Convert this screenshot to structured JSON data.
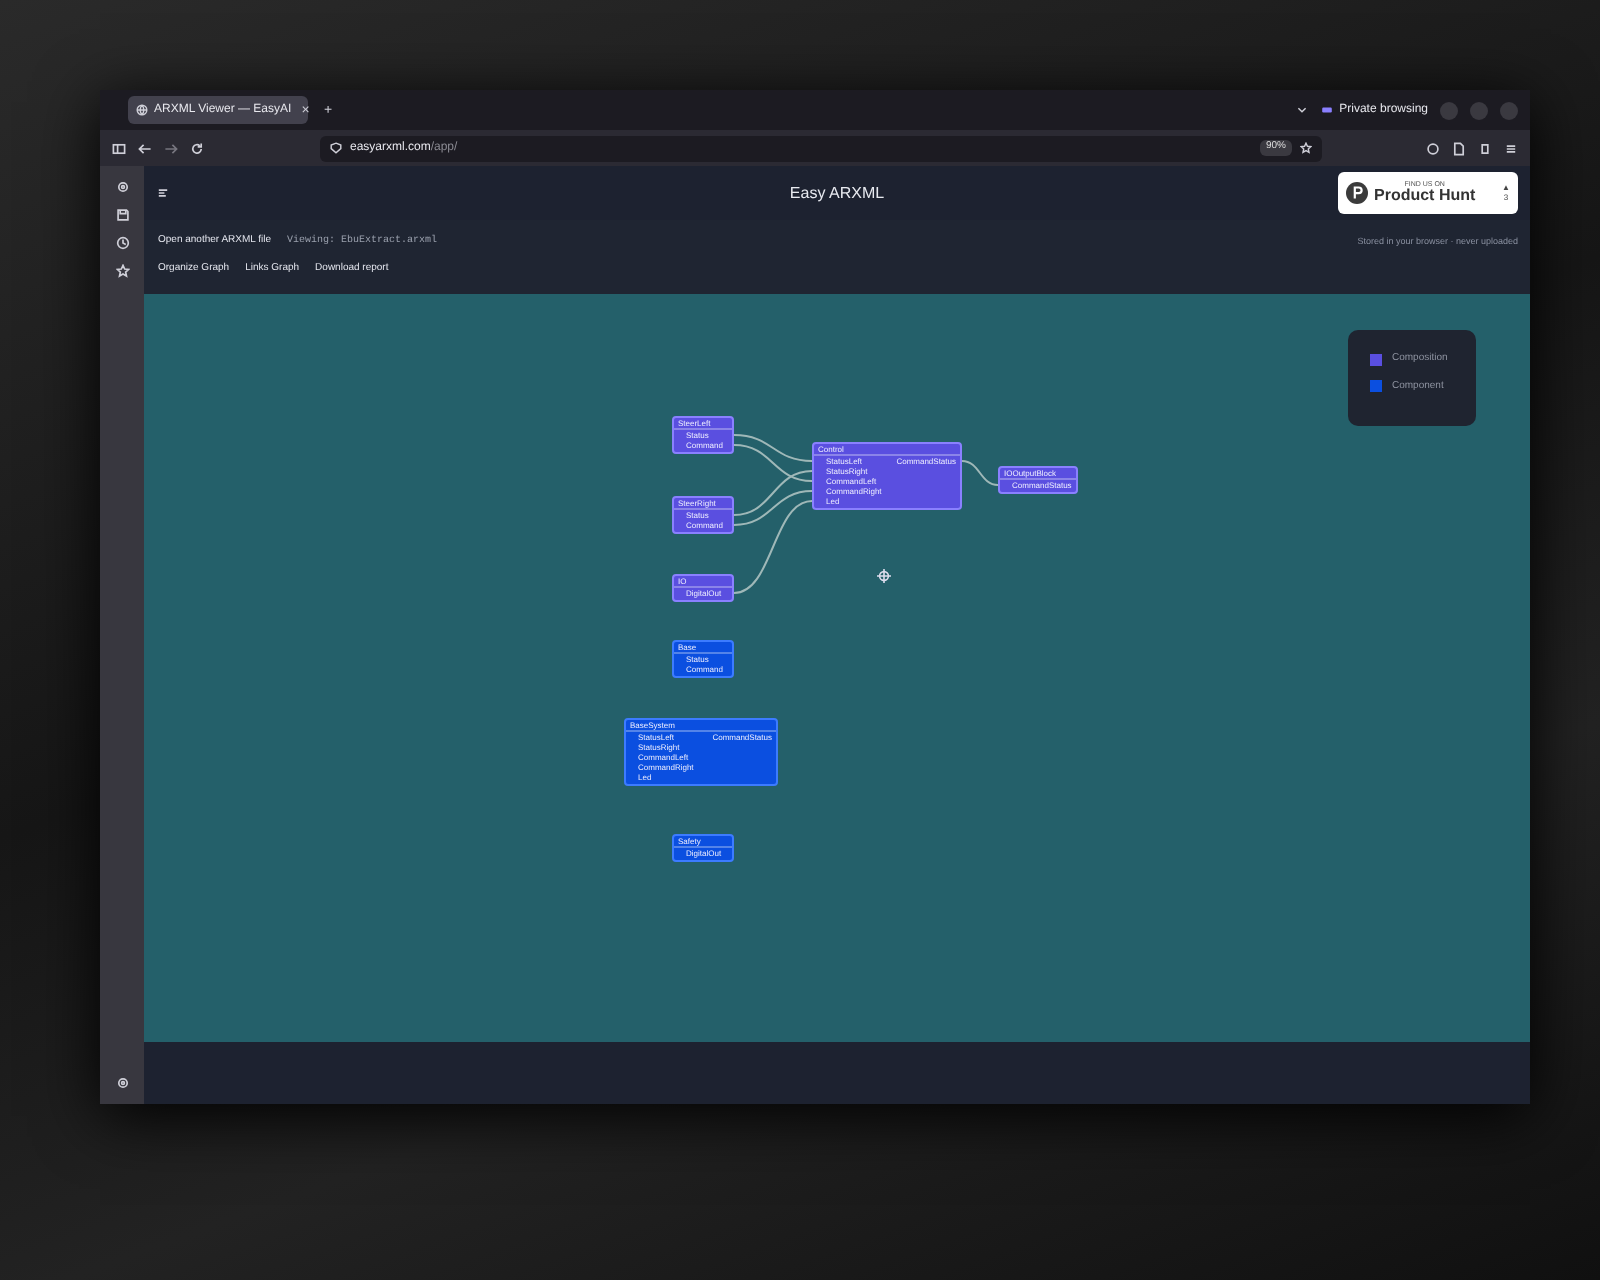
{
  "browser": {
    "tab_title": "ARXML Viewer — EasyAI",
    "tab_close": "×",
    "new_tab": "+",
    "private_label": "Private browsing",
    "url_host": "easyarxml.com",
    "url_path": "/app/",
    "zoom": "90%"
  },
  "app": {
    "title": "Easy ARXML",
    "badge": {
      "kicker": "FIND US ON",
      "name": "Product Hunt",
      "arrow": "▲",
      "count": "3"
    },
    "open_link": "Open another ARXML file",
    "viewing": "Viewing: EbuExtract.arxml",
    "privacy_note": "Stored in your browser · never uploaded",
    "actions": [
      "Organize Graph",
      "Links Graph",
      "Download report"
    ]
  },
  "legend": [
    {
      "kind": "composition",
      "label": "Composition",
      "color": "#5a4fe0"
    },
    {
      "kind": "component",
      "label": "Component",
      "color": "#0b4fe0"
    }
  ],
  "nodes": [
    {
      "label": "SteerLeft",
      "kind": "composition",
      "ports": [
        "Status",
        "Command"
      ]
    },
    {
      "label": "SteerRight",
      "kind": "composition",
      "ports": [
        "Status",
        "Command"
      ]
    },
    {
      "label": "IO",
      "kind": "composition",
      "ports": [
        "DigitalOut"
      ]
    },
    {
      "label": "Control",
      "kind": "composition",
      "ports": [
        "StatusLeft",
        "StatusRight",
        "CommandLeft",
        "CommandRight",
        "Led"
      ],
      "outputs": [
        "CommandStatus"
      ]
    },
    {
      "label": "IOOutputBlock",
      "kind": "composition",
      "ports": [
        "CommandStatus"
      ]
    },
    {
      "label": "Base",
      "kind": "component",
      "ports": [
        "Status",
        "Command"
      ]
    },
    {
      "label": "BaseSystem",
      "kind": "component",
      "ports": [
        "StatusLeft",
        "StatusRight",
        "CommandLeft",
        "CommandRight",
        "Led"
      ],
      "outputs": [
        "CommandStatus"
      ]
    },
    {
      "label": "Safety",
      "kind": "component",
      "ports": [
        "DigitalOut"
      ]
    }
  ]
}
